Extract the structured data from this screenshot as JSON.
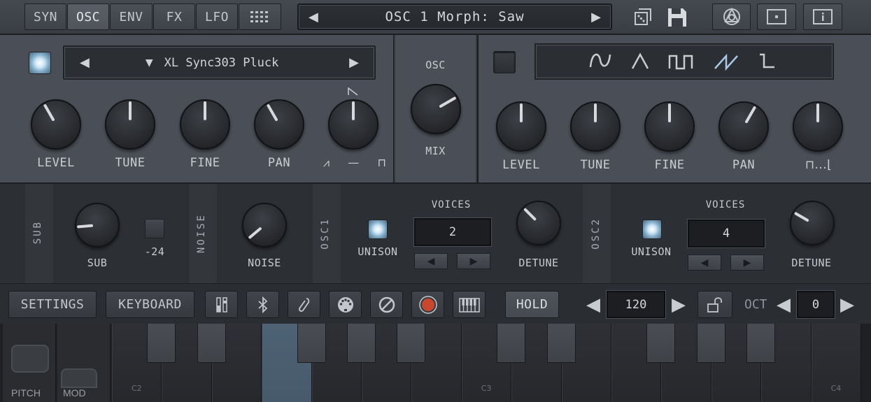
{
  "topbar": {
    "tabs": [
      {
        "label": "SYN",
        "active": false
      },
      {
        "label": "OSC",
        "active": true
      },
      {
        "label": "ENV",
        "active": false
      },
      {
        "label": "FX",
        "active": false
      },
      {
        "label": "LFO",
        "active": false
      }
    ],
    "preset": "OSC 1 Morph: Saw",
    "icons": [
      "grid-icon",
      "dice-icon",
      "save-icon",
      "audio-unit-icon",
      "window-icon",
      "info-icon"
    ]
  },
  "osc1": {
    "enabled": true,
    "sample_name": "XL Sync303 Pluck",
    "knobs": [
      {
        "label": "LEVEL",
        "angle": -30
      },
      {
        "label": "TUNE",
        "angle": 0
      },
      {
        "label": "FINE",
        "angle": 0
      },
      {
        "label": "PAN",
        "angle": -30
      },
      {
        "label": "",
        "angle": 0
      }
    ],
    "shape_labels": [
      "⩘",
      "—",
      "⊓"
    ]
  },
  "mix": {
    "title": "OSC",
    "label": "MIX",
    "angle": 60
  },
  "osc2": {
    "enabled": false,
    "waves": [
      "sine",
      "triangle",
      "square",
      "saw",
      "pulse"
    ],
    "selected_wave": "saw",
    "knobs": [
      {
        "label": "LEVEL",
        "angle": 0
      },
      {
        "label": "TUNE",
        "angle": 0
      },
      {
        "label": "FINE",
        "angle": 0
      },
      {
        "label": "PAN",
        "angle": 30
      },
      {
        "label": "",
        "angle": 0
      }
    ],
    "pw_label": "⊓...⌊"
  },
  "sub": {
    "section": "SUB",
    "knob_label": "SUB",
    "octave": "-24",
    "angle": -95
  },
  "noise": {
    "section": "NOISE",
    "knob_label": "NOISE",
    "angle": -130
  },
  "osc1_unison": {
    "section": "OSC1",
    "unison_label": "UNISON",
    "voices_title": "VOICES",
    "voices": "2",
    "detune_label": "DETUNE",
    "detune_angle": -45
  },
  "osc2_unison": {
    "section": "OSC2",
    "unison_label": "UNISON",
    "voices_title": "VOICES",
    "voices": "4",
    "detune_label": "DETUNE",
    "detune_angle": -60
  },
  "toolbar": {
    "settings": "SETTINGS",
    "keyboard": "KEYBOARD",
    "hold": "HOLD",
    "tempo": "120",
    "oct_label": "OCT",
    "octave": "0"
  },
  "keyboard": {
    "pitch_label": "PITCH",
    "mod_label": "MOD",
    "note_labels": [
      "C2",
      "C3",
      "C4"
    ]
  }
}
